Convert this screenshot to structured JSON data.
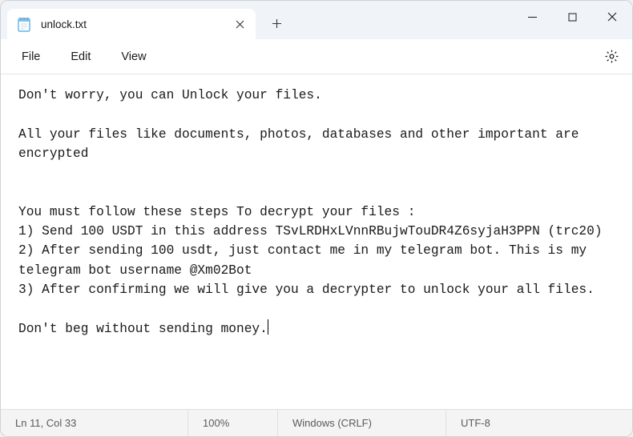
{
  "tab": {
    "title": "unlock.txt"
  },
  "menu": {
    "file": "File",
    "edit": "Edit",
    "view": "View"
  },
  "content": {
    "text": "Don't worry, you can Unlock your files.\n\nAll your files like documents, photos, databases and other important are encrypted\n\n\nYou must follow these steps To decrypt your files :\n1) Send 100 USDT in this address TSvLRDHxLVnnRBujwTouDR4Z6syjaH3PPN (trc20)\n2) After sending 100 usdt, just contact me in my telegram bot. This is my telegram bot username @Xm02Bot\n3) After confirming we will give you a decrypter to unlock your all files.\n\nDon't beg without sending money."
  },
  "status": {
    "position": "Ln 11, Col 33",
    "zoom": "100%",
    "line_ending": "Windows (CRLF)",
    "encoding": "UTF-8"
  }
}
